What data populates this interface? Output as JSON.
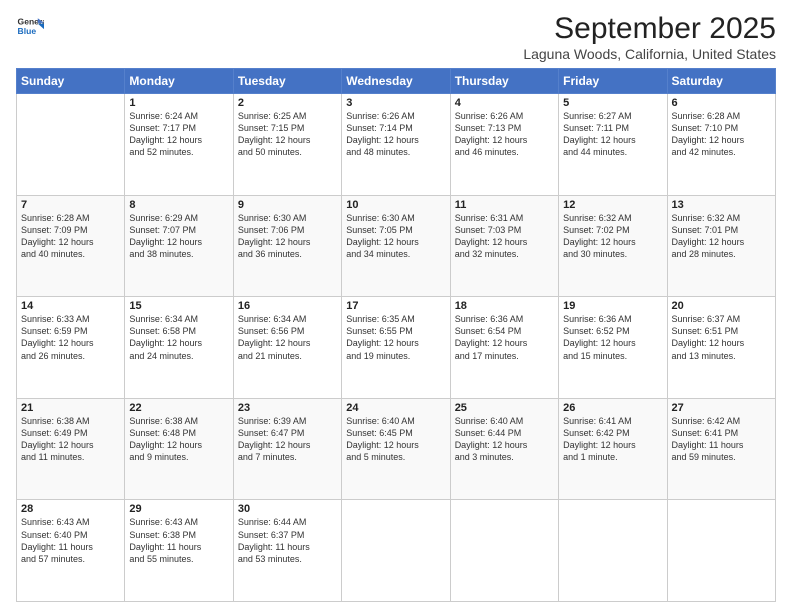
{
  "logo": {
    "general": "General",
    "blue": "Blue"
  },
  "title": "September 2025",
  "subtitle": "Laguna Woods, California, United States",
  "weekdays": [
    "Sunday",
    "Monday",
    "Tuesday",
    "Wednesday",
    "Thursday",
    "Friday",
    "Saturday"
  ],
  "weeks": [
    [
      {
        "day": "",
        "info": ""
      },
      {
        "day": "1",
        "info": "Sunrise: 6:24 AM\nSunset: 7:17 PM\nDaylight: 12 hours\nand 52 minutes."
      },
      {
        "day": "2",
        "info": "Sunrise: 6:25 AM\nSunset: 7:15 PM\nDaylight: 12 hours\nand 50 minutes."
      },
      {
        "day": "3",
        "info": "Sunrise: 6:26 AM\nSunset: 7:14 PM\nDaylight: 12 hours\nand 48 minutes."
      },
      {
        "day": "4",
        "info": "Sunrise: 6:26 AM\nSunset: 7:13 PM\nDaylight: 12 hours\nand 46 minutes."
      },
      {
        "day": "5",
        "info": "Sunrise: 6:27 AM\nSunset: 7:11 PM\nDaylight: 12 hours\nand 44 minutes."
      },
      {
        "day": "6",
        "info": "Sunrise: 6:28 AM\nSunset: 7:10 PM\nDaylight: 12 hours\nand 42 minutes."
      }
    ],
    [
      {
        "day": "7",
        "info": "Sunrise: 6:28 AM\nSunset: 7:09 PM\nDaylight: 12 hours\nand 40 minutes."
      },
      {
        "day": "8",
        "info": "Sunrise: 6:29 AM\nSunset: 7:07 PM\nDaylight: 12 hours\nand 38 minutes."
      },
      {
        "day": "9",
        "info": "Sunrise: 6:30 AM\nSunset: 7:06 PM\nDaylight: 12 hours\nand 36 minutes."
      },
      {
        "day": "10",
        "info": "Sunrise: 6:30 AM\nSunset: 7:05 PM\nDaylight: 12 hours\nand 34 minutes."
      },
      {
        "day": "11",
        "info": "Sunrise: 6:31 AM\nSunset: 7:03 PM\nDaylight: 12 hours\nand 32 minutes."
      },
      {
        "day": "12",
        "info": "Sunrise: 6:32 AM\nSunset: 7:02 PM\nDaylight: 12 hours\nand 30 minutes."
      },
      {
        "day": "13",
        "info": "Sunrise: 6:32 AM\nSunset: 7:01 PM\nDaylight: 12 hours\nand 28 minutes."
      }
    ],
    [
      {
        "day": "14",
        "info": "Sunrise: 6:33 AM\nSunset: 6:59 PM\nDaylight: 12 hours\nand 26 minutes."
      },
      {
        "day": "15",
        "info": "Sunrise: 6:34 AM\nSunset: 6:58 PM\nDaylight: 12 hours\nand 24 minutes."
      },
      {
        "day": "16",
        "info": "Sunrise: 6:34 AM\nSunset: 6:56 PM\nDaylight: 12 hours\nand 21 minutes."
      },
      {
        "day": "17",
        "info": "Sunrise: 6:35 AM\nSunset: 6:55 PM\nDaylight: 12 hours\nand 19 minutes."
      },
      {
        "day": "18",
        "info": "Sunrise: 6:36 AM\nSunset: 6:54 PM\nDaylight: 12 hours\nand 17 minutes."
      },
      {
        "day": "19",
        "info": "Sunrise: 6:36 AM\nSunset: 6:52 PM\nDaylight: 12 hours\nand 15 minutes."
      },
      {
        "day": "20",
        "info": "Sunrise: 6:37 AM\nSunset: 6:51 PM\nDaylight: 12 hours\nand 13 minutes."
      }
    ],
    [
      {
        "day": "21",
        "info": "Sunrise: 6:38 AM\nSunset: 6:49 PM\nDaylight: 12 hours\nand 11 minutes."
      },
      {
        "day": "22",
        "info": "Sunrise: 6:38 AM\nSunset: 6:48 PM\nDaylight: 12 hours\nand 9 minutes."
      },
      {
        "day": "23",
        "info": "Sunrise: 6:39 AM\nSunset: 6:47 PM\nDaylight: 12 hours\nand 7 minutes."
      },
      {
        "day": "24",
        "info": "Sunrise: 6:40 AM\nSunset: 6:45 PM\nDaylight: 12 hours\nand 5 minutes."
      },
      {
        "day": "25",
        "info": "Sunrise: 6:40 AM\nSunset: 6:44 PM\nDaylight: 12 hours\nand 3 minutes."
      },
      {
        "day": "26",
        "info": "Sunrise: 6:41 AM\nSunset: 6:42 PM\nDaylight: 12 hours\nand 1 minute."
      },
      {
        "day": "27",
        "info": "Sunrise: 6:42 AM\nSunset: 6:41 PM\nDaylight: 11 hours\nand 59 minutes."
      }
    ],
    [
      {
        "day": "28",
        "info": "Sunrise: 6:43 AM\nSunset: 6:40 PM\nDaylight: 11 hours\nand 57 minutes."
      },
      {
        "day": "29",
        "info": "Sunrise: 6:43 AM\nSunset: 6:38 PM\nDaylight: 11 hours\nand 55 minutes."
      },
      {
        "day": "30",
        "info": "Sunrise: 6:44 AM\nSunset: 6:37 PM\nDaylight: 11 hours\nand 53 minutes."
      },
      {
        "day": "",
        "info": ""
      },
      {
        "day": "",
        "info": ""
      },
      {
        "day": "",
        "info": ""
      },
      {
        "day": "",
        "info": ""
      }
    ]
  ]
}
